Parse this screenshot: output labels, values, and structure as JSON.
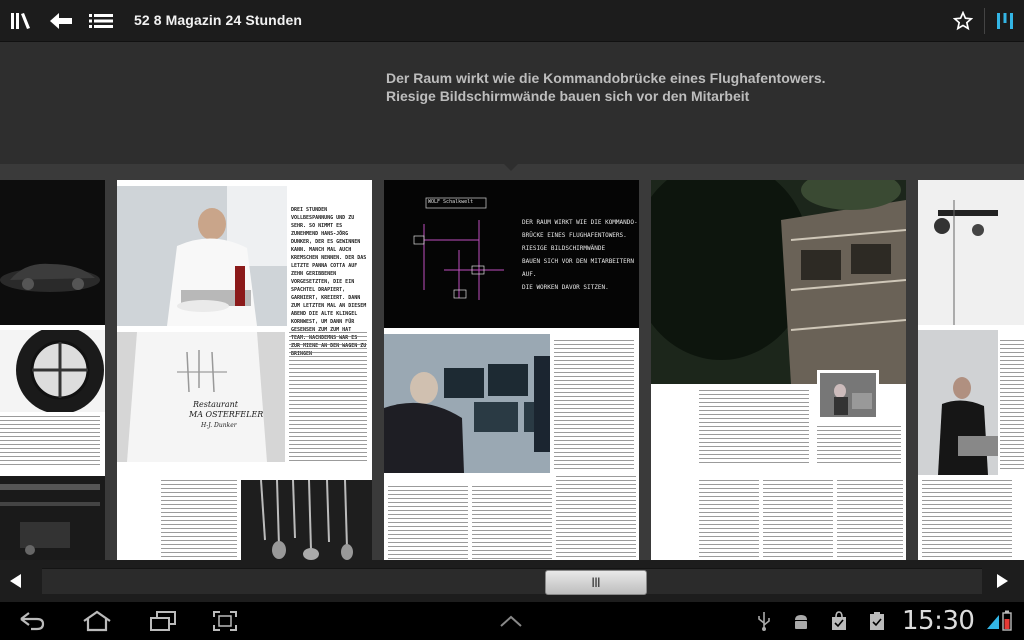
{
  "action_bar": {
    "title": "52 8 Magazin 24 Stunden",
    "icons": [
      "library-icon",
      "back-arrow-icon",
      "table-of-contents-icon",
      "star-icon",
      "page-overview-icon"
    ],
    "accent_color": "#33b5e5"
  },
  "caption": {
    "text": "Der Raum wirkt wie die Kommandobrücke eines Flughafentowers. Riesige Bildschirmwände bauen sich vor den Mitarbeit"
  },
  "pages": {
    "page2": {
      "intro_heading": "DREI STUNDEN VOLLBESPANNUNG UND ZU SEHR. SO NIMMT ES ZUNEHMEND HANS-JÖRG DUNKER, DER ES GEWINNEN KANN. MANCH MAL AUCH KREMSCHEN NENNEN. DER DAS LETZTE PANNA COTTA AUF ZEHN GERIBBENEN VORGESETZTEN, DIE EIN SPACHTEL DRAPIERT, GARNIERT, KREIERT. DANN ZUM LETZTEN MAL AN DIESEM ABEND DIE ALTE KLINGEL KORNWEST, UM DANN FÜR GESENSEN ZUM ZUM HAT TEAM. NACHDEMNS WAR ES ZUR MIENE AN DEN WAGEN ZU BRINGEN",
      "apron_text_1": "Restaurant",
      "apron_text_2": "MA OSTERFELER",
      "apron_text_3": "H-J. Dunker"
    },
    "page3": {
      "screen_label": "WOLF   Schalkwelt",
      "quote_line_1": "DER RAUM WIRKT WIE DIE KOMMANDO-",
      "quote_line_2": "BRÜCKE EINES FLUGHAFENTOWERS.",
      "quote_line_3": "RIESIGE BILDSCHIRMWÄNDE",
      "quote_line_4": "BAUEN SICH VOR DEN MITARBEITERN AUF.",
      "quote_line_5": "DIE WORKEN DAVOR SITZEN."
    }
  },
  "scroll": {
    "thumb_label": "|||",
    "position_fraction": 0.54
  },
  "system_bar": {
    "clock": "15:30",
    "icons": [
      "back-icon",
      "home-icon",
      "recent-apps-icon",
      "screenshot-icon",
      "up-chevron-icon",
      "usb-icon",
      "android-debug-icon",
      "shopping-bag-icon",
      "checklist-icon",
      "battery-icon"
    ]
  }
}
